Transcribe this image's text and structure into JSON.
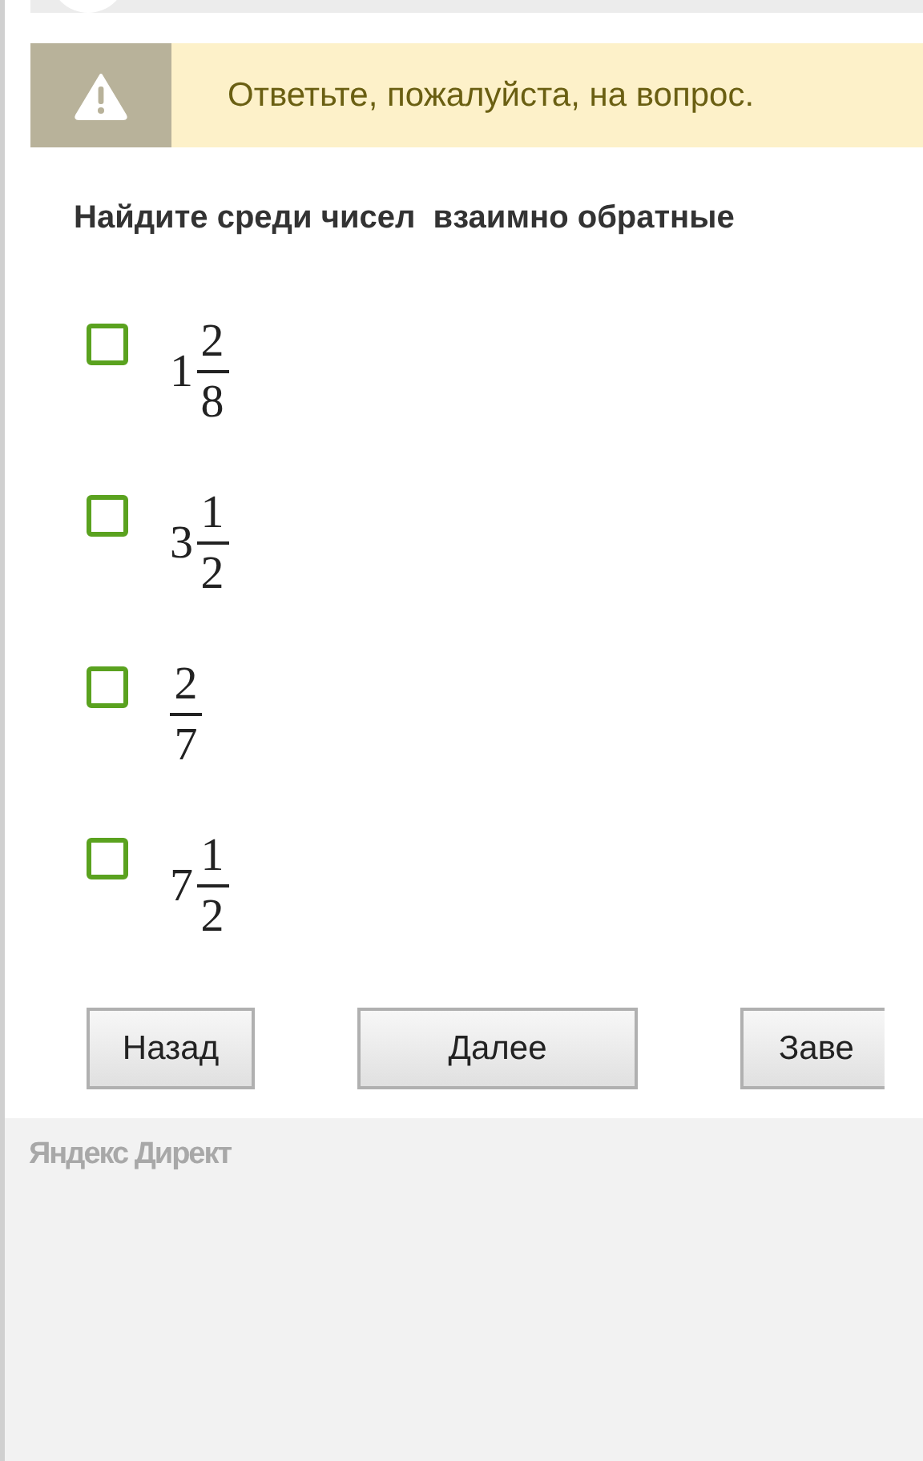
{
  "alert": {
    "message": "Ответьте, пожалуйста, на вопрос."
  },
  "question": "Найдите среди чисел  взаимно обратные",
  "options": [
    {
      "whole": "1",
      "numerator": "2",
      "denominator": "8",
      "checked": false
    },
    {
      "whole": "3",
      "numerator": "1",
      "denominator": "2",
      "checked": false
    },
    {
      "numerator": "2",
      "denominator": "7",
      "checked": false
    },
    {
      "whole": "7",
      "numerator": "1",
      "denominator": "2",
      "checked": false
    }
  ],
  "buttons": [
    {
      "label": "Назад",
      "kind": "small"
    },
    {
      "label": "Далее",
      "kind": "wide"
    },
    {
      "label": "Заве",
      "kind": "cut"
    }
  ],
  "ad_label": "Яндекс Директ"
}
